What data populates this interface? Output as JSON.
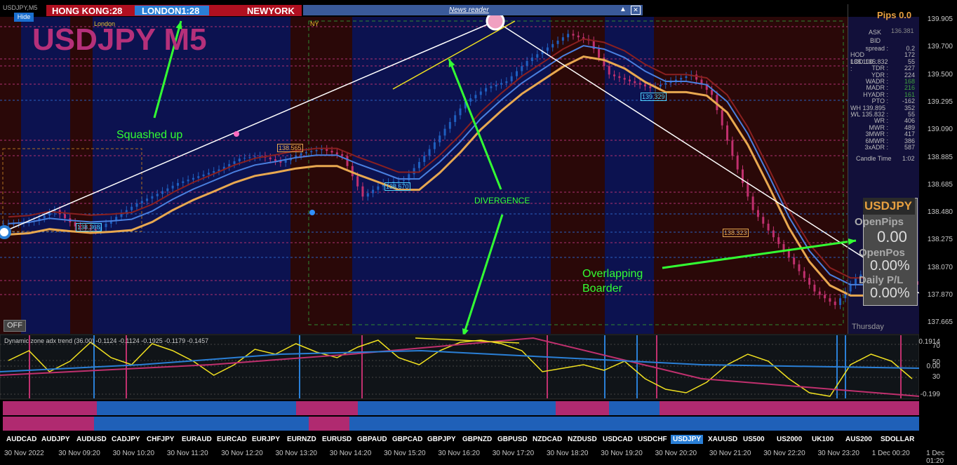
{
  "window": {
    "title": "USDJPY,M5",
    "hide_label": "Hide",
    "off_label": "OFF"
  },
  "sessions": {
    "hong_kong": "HONG KONG:28",
    "london": "LONDON1:28",
    "new_york": "NEWYORK"
  },
  "news_reader": {
    "label": "News reader"
  },
  "chart_title": "USDJPY M5",
  "session_labels": {
    "london": "London",
    "ny": "NY"
  },
  "annotations": {
    "squashed_up": "Squashed up",
    "divergence": "DIVERGENCE",
    "overlapping": "Overlapping\nBoarder"
  },
  "price_tags": {
    "t1": "138.368",
    "t2": "138.565",
    "t3": "138.670",
    "t4": "139.329",
    "t5": "138.323"
  },
  "stats_panel": {
    "pips": "Pips 0.0",
    "ask_label": "ASK",
    "ask": "136.381",
    "bid_label": "BID",
    "rows": [
      {
        "k": "spread :",
        "v": "0.2"
      },
      {
        "k": "HOD 138.100 :",
        "v": "172"
      },
      {
        "k": "LOD 135.832 :",
        "v": "55"
      },
      {
        "k": "TDR :",
        "v": "227"
      },
      {
        "k": "YDR :",
        "v": "224"
      },
      {
        "k": "WADR :",
        "v": "168"
      },
      {
        "k": "MADR :",
        "v": "216"
      },
      {
        "k": "HYADR :",
        "v": "161"
      },
      {
        "k": "PTO :",
        "v": "-162"
      },
      {
        "k": "WH 139.895 :",
        "v": "352"
      },
      {
        "k": "WL 135.832 :",
        "v": "55"
      },
      {
        "k": "WR :",
        "v": "406"
      },
      {
        "k": "MWR :",
        "v": "489"
      },
      {
        "k": "3MWR :",
        "v": "417"
      },
      {
        "k": "6MWR :",
        "v": "386"
      },
      {
        "k": "3xADR :",
        "v": "587"
      }
    ],
    "candle_time_label": "Candle Time",
    "candle_time": "1:02",
    "day": "Thursday"
  },
  "pnl_panel": {
    "symbol": "USDJPY",
    "open_pips_label": "OpenPips",
    "open_pips": "0.00",
    "open_pos_label": "OpenPos",
    "open_pos": "0.00%",
    "daily_pl_label": "Daily P/L",
    "daily_pl": "0.00%"
  },
  "indicator": {
    "label": "Dynamic zone adx trend (36.00) -0.1124 -0.1124 -0.1925 -0.1179 -0.1457"
  },
  "symbol_tabs": [
    "AUDCAD",
    "AUDJPY",
    "AUDUSD",
    "CADJPY",
    "CHFJPY",
    "EURAUD",
    "EURCAD",
    "EURJPY",
    "EURNZD",
    "EURUSD",
    "GBPAUD",
    "GBPCAD",
    "GBPJPY",
    "GBPNZD",
    "GBPUSD",
    "NZDCAD",
    "NZDUSD",
    "USDCAD",
    "USDCHF",
    "USDJPY",
    "XAUUSD",
    "US500",
    "US2000",
    "UK100",
    "AUS200",
    "SDOLLAR"
  ],
  "active_symbol": "USDJPY",
  "colors": {
    "bull": "#1f5fbf",
    "bear": "#c0306e",
    "band_outer": "#e8a850",
    "band_inner": "#4a80e0",
    "asian_bg": "#0c1250",
    "london_bg": "#2a0808",
    "annotation": "#33ff33"
  },
  "chart_data": {
    "type": "line",
    "y_axis_ticks": [
      "139.905",
      "139.700",
      "139.500",
      "139.295",
      "139.090",
      "138.885",
      "138.685",
      "138.480",
      "138.275",
      "138.070",
      "137.870",
      "137.665"
    ],
    "ylim": [
      137.665,
      139.905
    ],
    "x_axis_ticks": [
      "30 Nov 2022",
      "30 Nov 09:20",
      "30 Nov 10:20",
      "30 Nov 11:20",
      "30 Nov 12:20",
      "30 Nov 13:20",
      "30 Nov 14:20",
      "30 Nov 15:20",
      "30 Nov 16:20",
      "30 Nov 17:20",
      "30 Nov 18:20",
      "30 Nov 19:20",
      "30 Nov 20:20",
      "30 Nov 21:20",
      "30 Nov 22:20",
      "30 Nov 23:20",
      "1 Dec 00:20",
      "1 Dec 01:20"
    ],
    "series": [
      {
        "name": "",
        "values": [
          138.4,
          138.42,
          138.5,
          138.38,
          138.35,
          138.45,
          138.55,
          138.62,
          138.7,
          138.75,
          138.8,
          138.88,
          138.9,
          138.85,
          138.92,
          138.95,
          138.9,
          138.6,
          138.7,
          138.72,
          138.9,
          139.1,
          139.3,
          139.4,
          139.45,
          139.6,
          139.7,
          139.8,
          139.75,
          139.5,
          139.45,
          139.4,
          139.45,
          139.5,
          139.35,
          138.9,
          138.5,
          138.3,
          138.1,
          137.9,
          137.8,
          138.0,
          138.1,
          138.05,
          137.95
        ]
      }
    ],
    "indicator_ylim": [
      -0.199,
      0.1914
    ],
    "indicator_ticks": [
      "0.1914",
      "70",
      "50",
      "0.00",
      "30",
      "-0.199"
    ]
  }
}
